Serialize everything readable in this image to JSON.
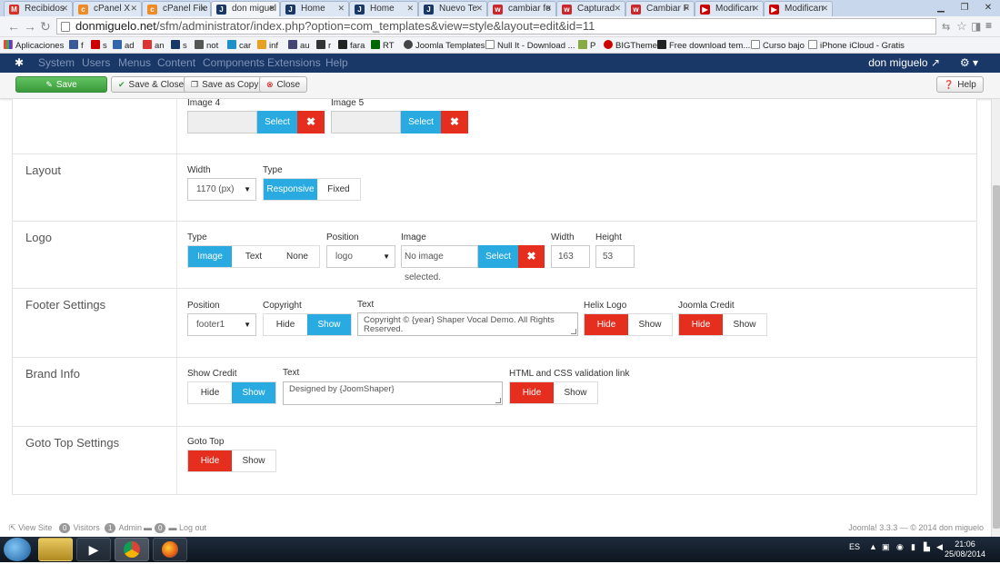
{
  "browser": {
    "tabs": [
      {
        "label": "Recibidos",
        "color": "#d93025",
        "glyph": "M"
      },
      {
        "label": "cPanel X",
        "color": "#f08a24",
        "glyph": "c"
      },
      {
        "label": "cPanel File",
        "color": "#f08a24",
        "glyph": "c"
      },
      {
        "label": "don miguel",
        "color": "#1a3867",
        "glyph": "J"
      },
      {
        "label": "Home",
        "color": "#1a3867",
        "glyph": "J"
      },
      {
        "label": "Home",
        "color": "#1a3867",
        "glyph": "J"
      },
      {
        "label": "Nuevo Te",
        "color": "#1a3867",
        "glyph": "J"
      },
      {
        "label": "cambiar fo",
        "color": "#c9282d",
        "glyph": "w"
      },
      {
        "label": "Capturad",
        "color": "#c9282d",
        "glyph": "w"
      },
      {
        "label": "Cambiar F",
        "color": "#c9282d",
        "glyph": "w"
      },
      {
        "label": "Modifican",
        "color": "#cc0000",
        "glyph": "▶"
      },
      {
        "label": "Modifican",
        "color": "#cc0000",
        "glyph": "▶"
      }
    ],
    "url_domain": "donmiguelo.net",
    "url_path": "/sfm/administrator/index.php?option=com_templates&view=style&layout=edit&id=11",
    "bookmarks": [
      "Aplicaciones",
      "f",
      "s",
      "ad",
      "an",
      "s",
      "not",
      "car",
      "inf",
      "au",
      "r",
      "fara",
      "RT",
      "Joomla Templates",
      "Null It - Download ...",
      "P",
      "BIGTheme",
      "Free download tem...",
      "Curso bajo",
      "iPhone iCloud - Gratis"
    ]
  },
  "joomla_nav": {
    "menu": [
      "System",
      "Users",
      "Menus",
      "Content",
      "Components",
      "Extensions",
      "Help"
    ],
    "user": "don miguelo"
  },
  "toolbar": {
    "save": "Save",
    "save_close": "Save & Close",
    "save_copy": "Save as Copy",
    "close": "Close",
    "help": "Help"
  },
  "images_row": {
    "image4_label": "Image 4",
    "image5_label": "Image 5",
    "select": "Select"
  },
  "layout": {
    "title": "Layout",
    "width_label": "Width",
    "width_value": "1170 (px)",
    "type_label": "Type",
    "type_options": [
      "Responsive",
      "Fixed"
    ],
    "type_selected": "Responsive"
  },
  "logo": {
    "title": "Logo",
    "type_label": "Type",
    "type_options": [
      "Image",
      "Text",
      "None"
    ],
    "type_selected": "Image",
    "position_label": "Position",
    "position_value": "logo",
    "image_label": "Image",
    "image_value": "No image selected.",
    "select": "Select",
    "width_label": "Width",
    "width_value": "163",
    "height_label": "Height",
    "height_value": "53"
  },
  "footer": {
    "title": "Footer Settings",
    "position_label": "Position",
    "position_value": "footer1",
    "copyright_label": "Copyright",
    "copyright_options": [
      "Hide",
      "Show"
    ],
    "copyright_selected": "Show",
    "text_label": "Text",
    "text_value": "Copyright ©  {year} Shaper Vocal Demo. All Rights Reserved.",
    "helix_label": "Helix Logo",
    "helix_options": [
      "Hide",
      "Show"
    ],
    "helix_selected": "Hide",
    "credit_label": "Joomla Credit",
    "credit_options": [
      "Hide",
      "Show"
    ],
    "credit_selected": "Hide"
  },
  "brand": {
    "title": "Brand Info",
    "show_credit_label": "Show Credit",
    "show_credit_options": [
      "Hide",
      "Show"
    ],
    "show_credit_selected": "Show",
    "text_label": "Text",
    "text_value": "Designed by {JoomShaper}",
    "validation_label": "HTML and CSS validation link",
    "validation_options": [
      "Hide",
      "Show"
    ],
    "validation_selected": "Hide"
  },
  "gototop": {
    "title": "Goto Top Settings",
    "label": "Goto Top",
    "options": [
      "Hide",
      "Show"
    ],
    "selected": "Hide"
  },
  "status_footer": {
    "view_site": "View Site",
    "visitors_count": "0",
    "visitors": "Visitors",
    "admin_count": "1",
    "admin": "Admin",
    "logout_count": "0",
    "logout": "Log out",
    "version": "Joomla! 3.3.3 — © 2014 don miguelo"
  },
  "taskbar": {
    "lang": "ES",
    "time": "21:06",
    "date": "25/08/2014"
  },
  "colors": {
    "blue": "#29abe2",
    "red": "#e52e1e",
    "green": "#4cae4c",
    "nav": "#1a3867"
  }
}
